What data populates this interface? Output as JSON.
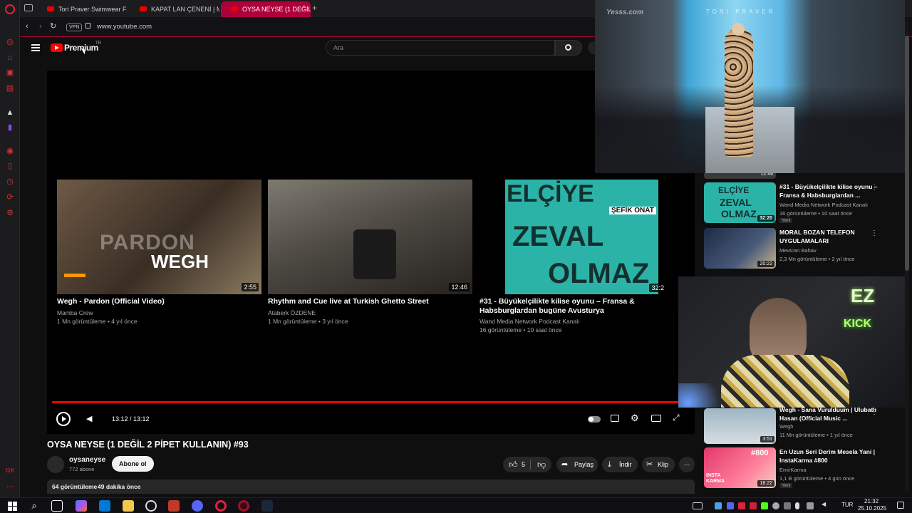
{
  "browser": {
    "tabs": [
      {
        "label": "Tori Praver Swimwear Fa"
      },
      {
        "label": "KAPAT LAN ÇENENİ | Ma"
      },
      {
        "label": "OYSA NEYSE (1 DEĞİL 2 P"
      }
    ],
    "vpn_label": "VPN",
    "url": "www.youtube.com"
  },
  "header": {
    "logo_text": "Premium",
    "logo_superscript": "TR",
    "search_placeholder": "Ara"
  },
  "player": {
    "time": "13:12 / 13:12",
    "endscreen_cards": [
      {
        "title": "Wegh - Pardon (Official Video)",
        "channel": "Mamba Crew",
        "meta": "1 Mn görüntüleme • 4 yıl önce",
        "duration": "2:55",
        "thumb_text_1": "PARDON",
        "thumb_text_2": "WEGH"
      },
      {
        "title": "Rhythm and Cue live at Turkish Ghetto Street",
        "channel": "Ataberk ÖZDENE",
        "meta": "1 Mn görüntüleme • 3 yıl önce",
        "duration": "12:46"
      },
      {
        "title": "#31 - Büyükelçilikte kilise oyunu – Fransa & Habsburglardan bugüne Avusturya",
        "channel": "Wand Media Network Podcast Kanalı",
        "meta": "16 görüntüleme • 10 saat önce",
        "duration": "32:2",
        "thumb_line_1": "ELÇİYE",
        "thumb_line_2": "ZEVAL",
        "thumb_line_3": "OLMAZ",
        "thumb_badge": "ŞEFİK ONAT"
      }
    ]
  },
  "video": {
    "title": "OYSA NEYSE (1 DEĞİL 2 PİPET KULLANIN) #93",
    "channel_name": "oysaneyse",
    "subscribers": "772 abone",
    "subscribe_label": "Abone ol",
    "likes": "5",
    "share_label": "Paylaş",
    "download_label": "İndir",
    "clip_label": "Klip",
    "views": "64 görüntüleme",
    "age": "49 dakika önce"
  },
  "overlay": {
    "watermark": "Yesss.com",
    "runway_text": "TORI PRAVER",
    "kick_line_1": "EZ",
    "kick_line_2": "KICK"
  },
  "related": [
    {
      "title": "#31 - Büyükelçilikte kilise oyunu – Fransa & Habsburglardan ...",
      "channel": "Wand Media Network Podcast Kanalı",
      "meta": "16 görüntüleme • 10 saat önce",
      "badge": "Yeni",
      "duration": "32:20",
      "prev_duration": "12:46"
    },
    {
      "title": "MORAL BOZAN TELEFON UYGULAMALARI",
      "channel": "Mevtcan Bahav",
      "meta": "2,3 Mn görüntüleme • 2 yıl önce",
      "duration": "20:22"
    },
    {
      "title": "Wegh - Sana Vurulduum | Ulubatlı Hasan (Official Music ...",
      "channel": "Wegh",
      "meta": "11 Mn görüntüleme • 1 yıl önce",
      "duration": "3:51"
    },
    {
      "title": "En Uzun Seri Derim Mesela Yani | InstaKarma #800",
      "channel": "EmirKarma",
      "meta": "1,1 B görüntüleme • 4 gün önce",
      "badge": "Yeni",
      "duration": "18:22",
      "thumb_text": "#800",
      "thumb_text_2": "INSTA KARMA"
    }
  ],
  "taskbar": {
    "language": "TUR",
    "time": "21:32",
    "date": "25.10.2025"
  }
}
